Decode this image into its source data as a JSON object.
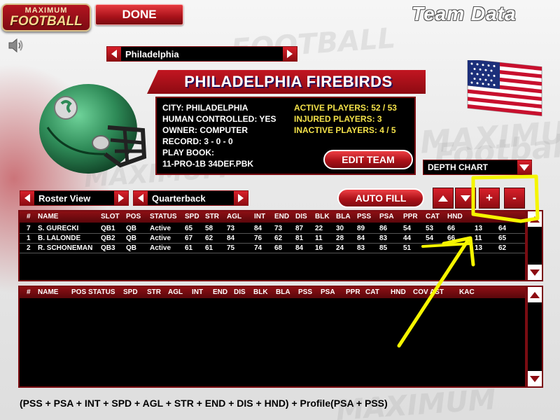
{
  "app": {
    "logo_line1": "MAXIMUM",
    "logo_line2": "FOOTBALL",
    "done_label": "DONE",
    "screen_title": "Team Data",
    "background_words": [
      "FOOTBALL",
      "MAXIMUM",
      "Football",
      "MAXIMUM",
      "MAXIMUM"
    ]
  },
  "team_selector": {
    "value": "Philadelphia"
  },
  "team": {
    "name": "PHILADELPHIA FIREBIRDS",
    "helmet_color": "#2e8a57",
    "info_left": [
      "CITY: PHILADELPHIA",
      "HUMAN CONTROLLED: YES",
      "OWNER: COMPUTER",
      "RECORD: 3 - 0 - 0",
      "PLAY BOOK:",
      "11-PRO-1B 34DEF.PBK"
    ],
    "info_right": [
      "ACTIVE PLAYERS:  52 / 53",
      "INJURED PLAYERS:  3",
      "INACTIVE PLAYERS: 4 / 5"
    ],
    "edit_label": "EDIT TEAM"
  },
  "depth_chart_select": {
    "value": "DEPTH CHART"
  },
  "controls": {
    "view_select": "Roster View",
    "position_select": "Quarterback",
    "auto_fill_label": "AUTO FILL",
    "plus_label": "+",
    "minus_label": "-"
  },
  "roster_table": {
    "columns": [
      "#",
      "NAME",
      "SLOT",
      "POS",
      "STATUS",
      "SPD",
      "STR",
      "AGL",
      "INT",
      "END",
      "DIS",
      "BLK",
      "BLA",
      "PSS",
      "PSA",
      "PPR",
      "CAT",
      "HND",
      "",
      ""
    ],
    "rows": [
      [
        "7",
        "S. GURECKI",
        "QB1",
        "QB",
        "Active",
        "65",
        "58",
        "73",
        "84",
        "73",
        "87",
        "22",
        "30",
        "89",
        "86",
        "54",
        "53",
        "66",
        "13",
        "64"
      ],
      [
        "1",
        "B. LALONDE",
        "QB2",
        "QB",
        "Active",
        "67",
        "62",
        "84",
        "76",
        "62",
        "81",
        "11",
        "28",
        "84",
        "83",
        "44",
        "54",
        "66",
        "11",
        "65"
      ],
      [
        "2",
        "R. SCHONEMAN",
        "QB3",
        "QB",
        "Active",
        "61",
        "61",
        "75",
        "74",
        "68",
        "84",
        "16",
        "24",
        "83",
        "85",
        "51",
        "",
        "",
        "13",
        "62"
      ]
    ]
  },
  "available_table": {
    "columns": [
      "#",
      "NAME",
      "POS",
      "STATUS",
      "SPD",
      "STR",
      "AGL",
      "INT",
      "END",
      "DIS",
      "BLK",
      "BLA",
      "PSS",
      "PSA",
      "PPR",
      "CAT",
      "HND",
      "COV",
      "AST",
      "KAC"
    ]
  },
  "formula_text": "(PSS + PSA + INT + SPD + AGL + STR + END + DIS + HND) + Profile(PSA + PSS)",
  "colors": {
    "accent_red": "#b31420",
    "info_yellow": "#f4e24a",
    "annotation_yellow": "#f5f500"
  }
}
